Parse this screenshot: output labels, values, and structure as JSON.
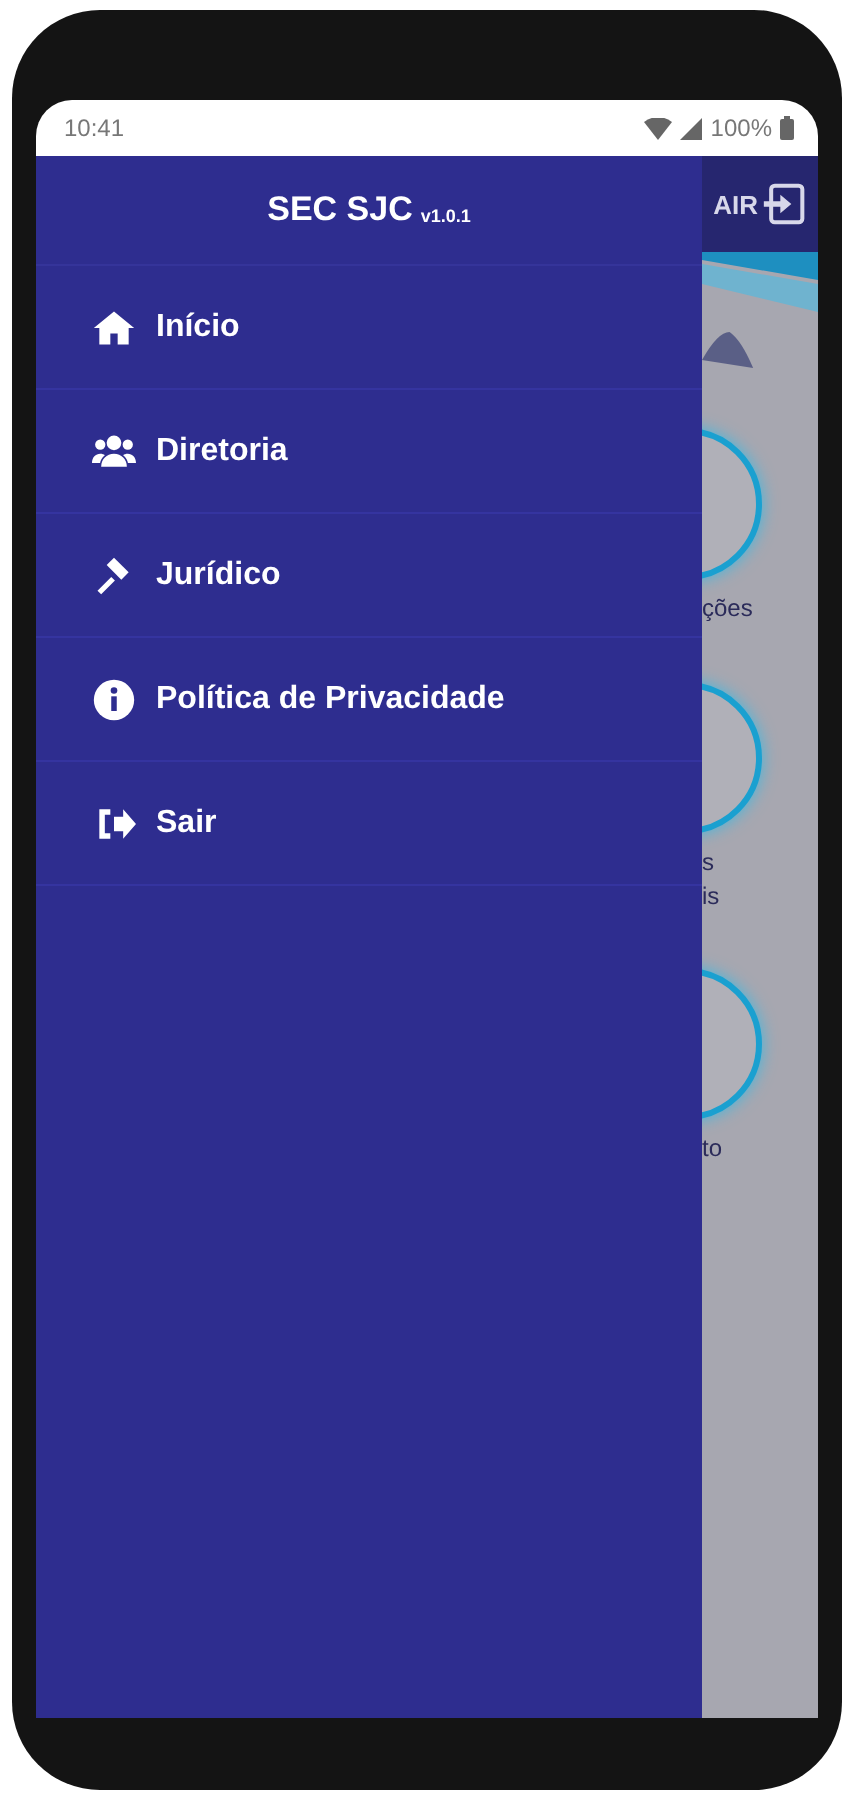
{
  "status_bar": {
    "time": "10:41",
    "battery": "100%"
  },
  "drawer": {
    "title": "SEC SJC",
    "version": "v1.0.1",
    "items": [
      {
        "label": "Início",
        "kind": "home"
      },
      {
        "label": "Diretoria",
        "kind": "users"
      },
      {
        "label": "Jurídico",
        "kind": "gavel"
      },
      {
        "label": "Política de Privacidade",
        "kind": "info"
      },
      {
        "label": "Sair",
        "kind": "signout"
      }
    ]
  },
  "background": {
    "header_action": "AIR",
    "tiles": [
      {
        "label_lines": [
          "ções"
        ]
      },
      {
        "label_lines": [
          "s",
          "is"
        ]
      },
      {
        "label_lines": [
          "to"
        ]
      }
    ]
  }
}
